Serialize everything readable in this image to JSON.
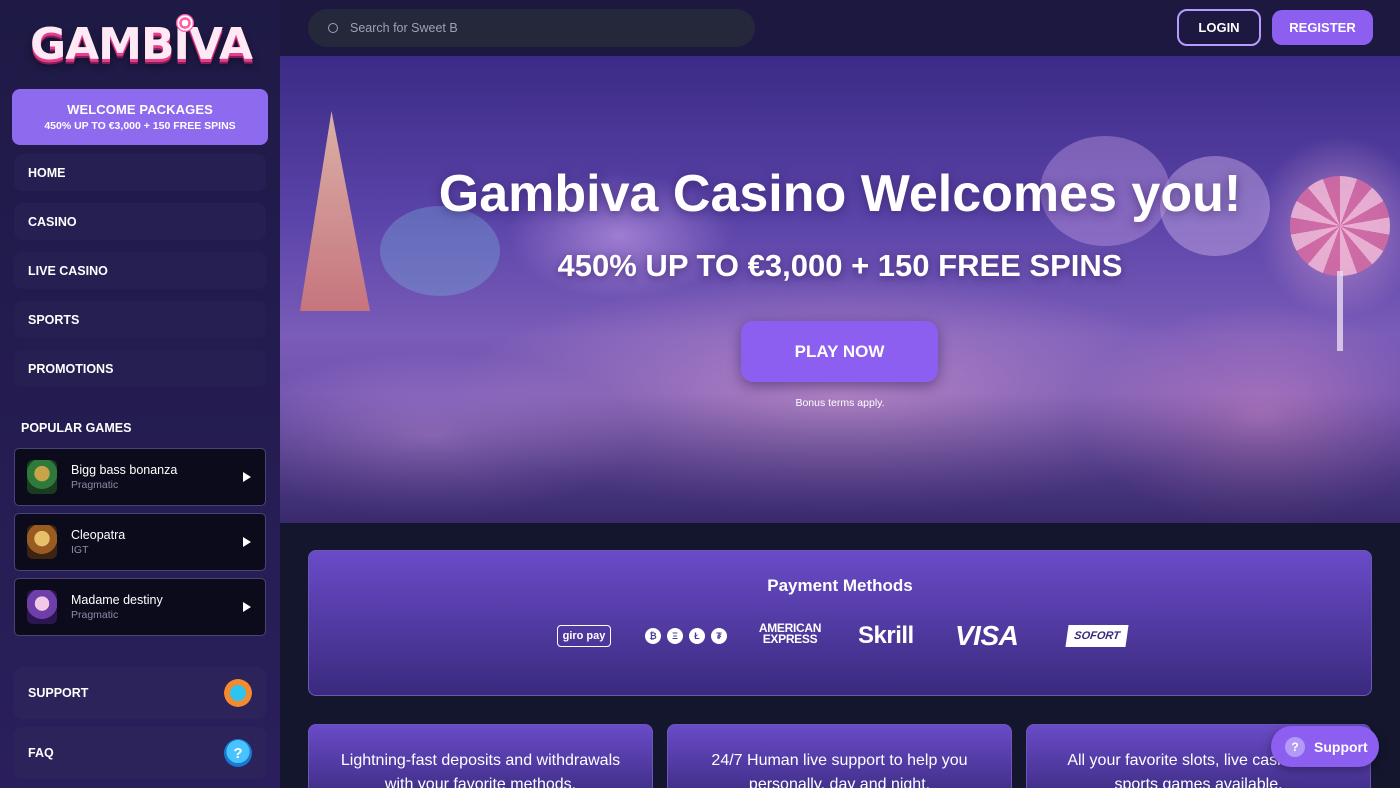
{
  "logo": {
    "text": "GAMBIVA"
  },
  "welcome": {
    "line1": "WELCOME PACKAGES",
    "line2": "450% UP TO €3,000 + 150 FREE SPINS"
  },
  "nav": [
    "HOME",
    "CASINO",
    "LIVE CASINO",
    "SPORTS",
    "PROMOTIONS"
  ],
  "popular": {
    "title": "POPULAR GAMES",
    "games": [
      {
        "name": "Bigg bass bonanza",
        "provider": "Pragmatic"
      },
      {
        "name": "Cleopatra",
        "provider": "IGT"
      },
      {
        "name": "Madame destiny",
        "provider": "Pragmatic"
      }
    ]
  },
  "help": {
    "support": "SUPPORT",
    "faq": "FAQ"
  },
  "search": {
    "placeholder": "Search for Sweet B"
  },
  "auth": {
    "login": "LOGIN",
    "register": "REGISTER"
  },
  "hero": {
    "title": "Gambiva Casino Welcomes you!",
    "subtitle": "450% UP TO €3,000 + 150 FREE SPINS",
    "cta": "PLAY NOW",
    "terms": "Bonus terms apply."
  },
  "payment": {
    "title": "Payment Methods",
    "methods": {
      "giropay": "giro pay",
      "crypto": [
        "₿",
        "Ξ",
        "Ł",
        "₮"
      ],
      "amex_line1": "AMERICAN",
      "amex_line2": "EXPRESS",
      "skrill": "Skrill",
      "visa": "VISA",
      "sofort": "SOFORT"
    }
  },
  "features": [
    "Lightning-fast deposits and withdrawals with your favorite methods.",
    "24/7 Human live support to help you personally, day and night.",
    "All your favorite slots, live casino and sports games available."
  ],
  "support_float": {
    "label": "Support",
    "icon": "?"
  },
  "colors": {
    "accent": "#8d5ff0",
    "sidebar": "#1e1a45",
    "background": "#14162e"
  }
}
